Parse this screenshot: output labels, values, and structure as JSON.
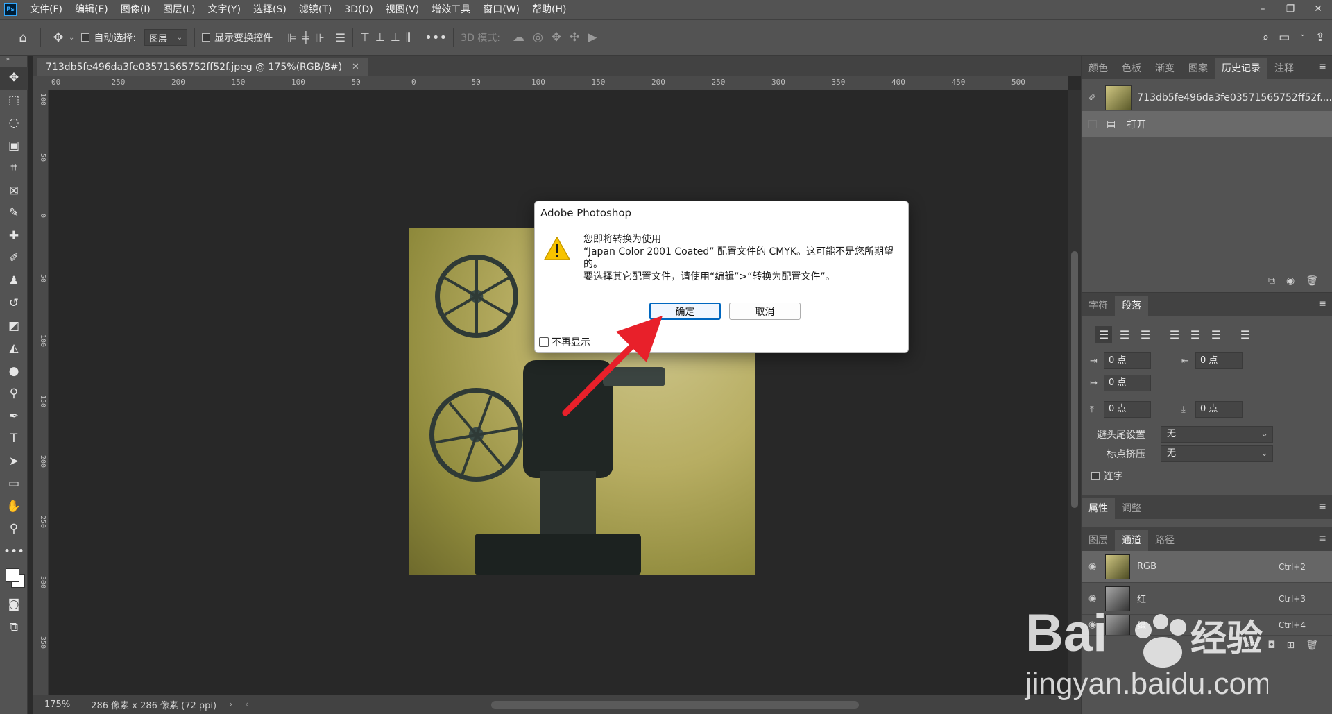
{
  "app": {
    "logo": "Ps"
  },
  "menu": [
    "文件(F)",
    "编辑(E)",
    "图像(I)",
    "图层(L)",
    "文字(Y)",
    "选择(S)",
    "滤镜(T)",
    "3D(D)",
    "视图(V)",
    "增效工具",
    "窗口(W)",
    "帮助(H)"
  ],
  "options": {
    "auto_select_label": "自动选择:",
    "auto_select_value": "图层",
    "show_transform_label": "显示变换控件",
    "mode_3d_label": "3D 模式:"
  },
  "document": {
    "tab_title": "713db5fe496da3fe03571565752ff52f.jpeg @ 175%(RGB/8#)",
    "ruler_top": [
      "00",
      "250",
      "200",
      "150",
      "100",
      "50",
      "0",
      "50",
      "100",
      "150",
      "200",
      "250",
      "300",
      "350",
      "400",
      "450",
      "500"
    ],
    "ruler_left": [
      "100",
      "50",
      "0",
      "50",
      "100",
      "150",
      "200",
      "250",
      "300",
      "350"
    ],
    "zoom": "175%",
    "doc_info": "286 像素 x 286 像素 (72 ppi)"
  },
  "dialog": {
    "title": "Adobe Photoshop",
    "line1": "您即将转换为使用",
    "line2": "“Japan Color 2001 Coated” 配置文件的 CMYK。这可能不是您所期望",
    "line3": "的。",
    "line4": "要选择其它配置文件，请使用“编辑”>“转换为配置文件”。",
    "ok_label": "确定",
    "cancel_label": "取消",
    "dont_show_label": "不再显示"
  },
  "history_panel": {
    "tabs": [
      "颜色",
      "色板",
      "渐变",
      "图案",
      "历史记录",
      "注释"
    ],
    "active_tab": "历史记录",
    "snapshot_name": "713db5fe496da3fe03571565752ff52f....",
    "steps": [
      "打开"
    ]
  },
  "paragraph_panel": {
    "tabs": [
      "字符",
      "段落"
    ],
    "active_tab": "段落",
    "indent_left": "0 点",
    "indent_right": "0 点",
    "indent_first": "0 点",
    "space_before": "0 点",
    "space_after": "0 点",
    "kinsoku_label": "避头尾设置",
    "kinsoku_value": "无",
    "mojikumi_label": "标点挤压",
    "mojikumi_value": "无",
    "hyphenate_label": "连字"
  },
  "properties_panel": {
    "tabs": [
      "属性",
      "调整"
    ],
    "active_tab": "属性"
  },
  "channels_panel": {
    "tabs": [
      "图层",
      "通道",
      "路径"
    ],
    "active_tab": "通道",
    "channels": [
      {
        "name": "RGB",
        "shortcut": "Ctrl+2"
      },
      {
        "name": "红",
        "shortcut": "Ctrl+3"
      },
      {
        "name": "绿",
        "shortcut": "Ctrl+4"
      }
    ]
  },
  "watermark": {
    "brand": "Bai",
    "brand_cn": "经验",
    "url": "jingyan.baidu.com"
  },
  "colors": {
    "accent_blue": "#0067c0",
    "arrow_red": "#e8202a",
    "warning_yellow": "#f7c300"
  }
}
